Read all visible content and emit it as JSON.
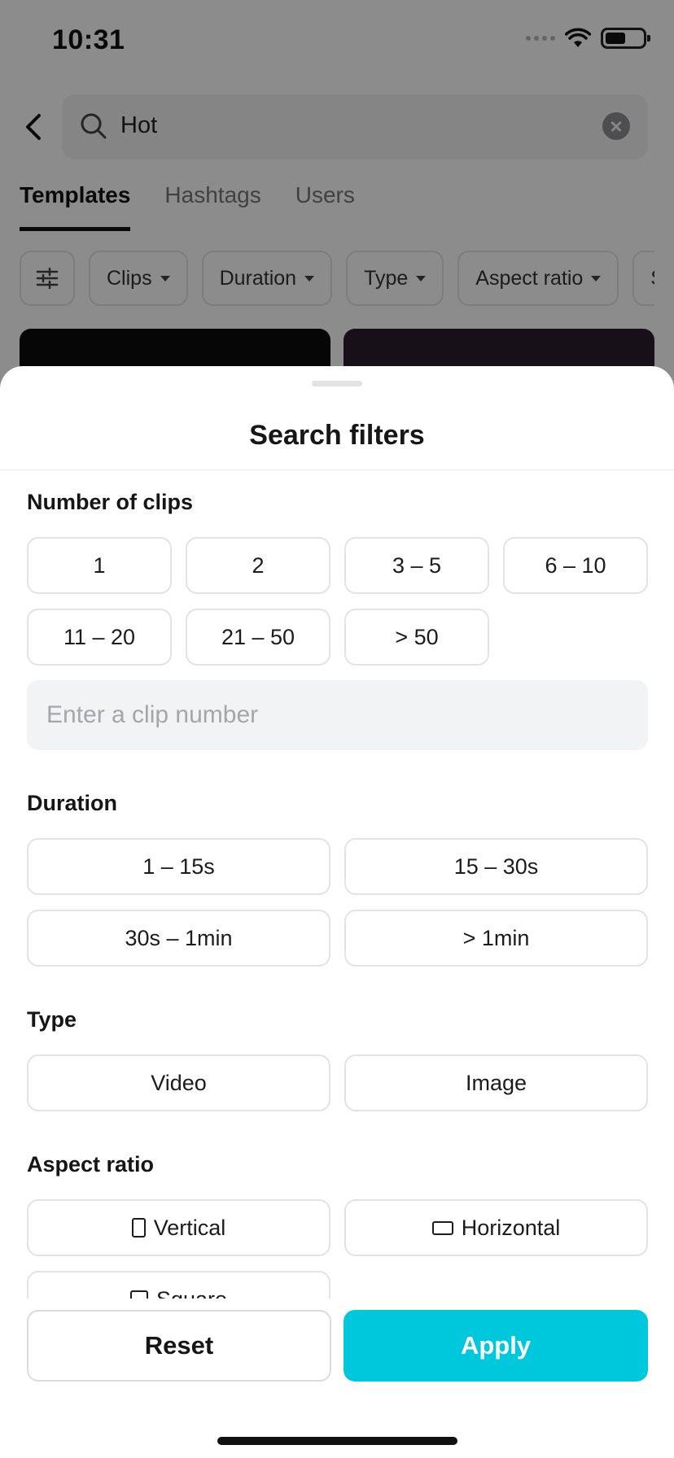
{
  "status_bar": {
    "time": "10:31"
  },
  "search": {
    "query": "Hot"
  },
  "tabs": [
    {
      "label": "Templates",
      "active": true
    },
    {
      "label": "Hashtags",
      "active": false
    },
    {
      "label": "Users",
      "active": false
    }
  ],
  "filter_chips": [
    "Clips",
    "Duration",
    "Type",
    "Aspect ratio",
    "St"
  ],
  "sheet": {
    "title": "Search filters",
    "clips": {
      "title": "Number of clips",
      "options": [
        "1",
        "2",
        "3 – 5",
        "6 – 10",
        "11 – 20",
        "21 – 50",
        "> 50"
      ],
      "input_placeholder": "Enter a clip number"
    },
    "duration": {
      "title": "Duration",
      "options": [
        "1 – 15s",
        "15 – 30s",
        "30s – 1min",
        "> 1min"
      ]
    },
    "type": {
      "title": "Type",
      "options": [
        "Video",
        "Image"
      ]
    },
    "aspect_ratio": {
      "title": "Aspect ratio",
      "options": [
        "Vertical",
        "Horizontal",
        "Square"
      ]
    },
    "reset_label": "Reset",
    "apply_label": "Apply"
  },
  "colors": {
    "accent": "#00c8dc",
    "border": "#e3e3e5",
    "input_bg": "#f2f3f4"
  }
}
